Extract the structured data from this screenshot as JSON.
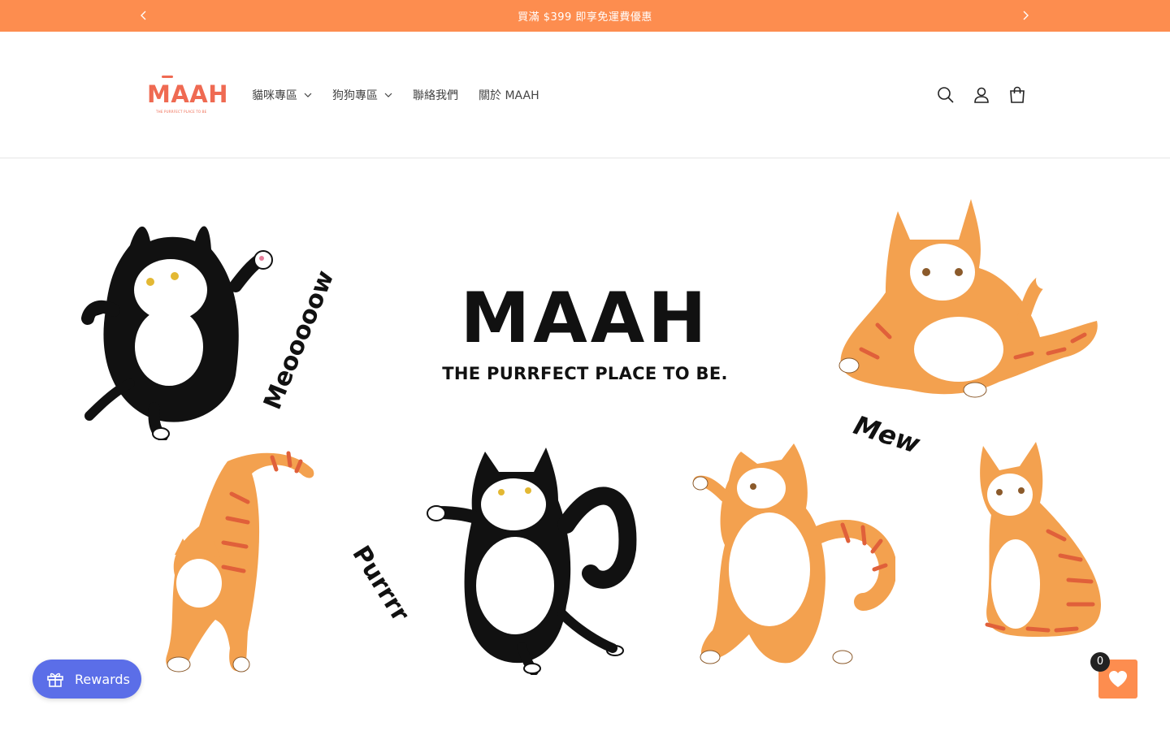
{
  "announcement": {
    "message": "買滿 $399 即享免運費優惠",
    "prev_icon": "chevron-left-icon",
    "next_icon": "chevron-right-icon"
  },
  "header": {
    "logo_text": "MAAH",
    "logo_tagline": "THE PURRFECT PLACE TO BE",
    "nav": [
      {
        "label": "貓咪專區",
        "has_dropdown": true
      },
      {
        "label": "狗狗專區",
        "has_dropdown": true
      },
      {
        "label": "聯絡我們",
        "has_dropdown": false
      },
      {
        "label": "關於 MAAH",
        "has_dropdown": false
      }
    ],
    "icons": [
      "search-icon",
      "account-icon",
      "cart-icon"
    ]
  },
  "hero": {
    "brand": "MAAH",
    "tagline": "THE PURRFECT PLACE TO BE.",
    "doodles": {
      "meow": "Meooooow",
      "mew": "Mew",
      "purr": "Purrrr"
    }
  },
  "widgets": {
    "rewards_label": "Rewards",
    "wishlist_count": "0"
  },
  "colors": {
    "announcement_bg": "#fd8d4f",
    "brand_orange": "#ef6a52",
    "rewards_bg": "#5b6ee8",
    "cat_orange": "#f3a14f",
    "cat_stripe": "#e0603a"
  }
}
